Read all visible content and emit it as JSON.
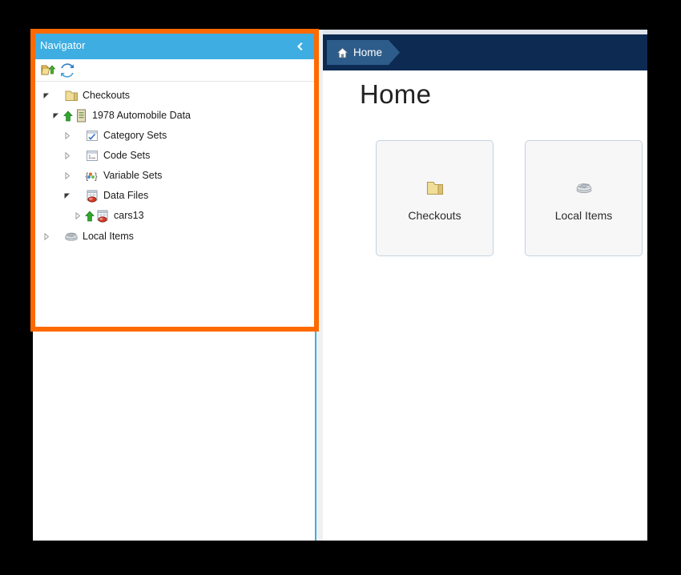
{
  "window": {
    "background_color": "#ffffff",
    "outer_background_color": "#000000"
  },
  "highlight": {
    "color": "#ff6a00",
    "target": "navigator-panel"
  },
  "navigator": {
    "title": "Navigator",
    "header_color": "#3eaee2",
    "collapse_icon": "chevron-left-double-icon",
    "toolbar": [
      {
        "name": "open-folder-up-icon",
        "tooltip": "Open"
      },
      {
        "name": "refresh-icon",
        "tooltip": "Refresh"
      }
    ],
    "tree": [
      {
        "label": "Checkouts",
        "icon": "folder-icon",
        "depth": 0,
        "expanded": true,
        "has_children": true,
        "has_up_arrow": false
      },
      {
        "label": "1978 Automobile Data",
        "icon": "project-document-icon",
        "depth": 1,
        "expanded": true,
        "has_children": true,
        "has_up_arrow": true
      },
      {
        "label": "Category Sets",
        "icon": "category-sets-icon",
        "depth": 2,
        "expanded": false,
        "has_children": true,
        "has_up_arrow": false
      },
      {
        "label": "Code Sets",
        "icon": "code-sets-icon",
        "depth": 2,
        "expanded": false,
        "has_children": true,
        "has_up_arrow": false
      },
      {
        "label": "Variable Sets",
        "icon": "variable-sets-icon",
        "depth": 2,
        "expanded": false,
        "has_children": true,
        "has_up_arrow": false
      },
      {
        "label": "Data Files",
        "icon": "data-files-icon",
        "depth": 2,
        "expanded": true,
        "has_children": true,
        "has_up_arrow": false
      },
      {
        "label": "cars13",
        "icon": "data-file-icon",
        "depth": 3,
        "expanded": false,
        "has_children": true,
        "has_up_arrow": true
      },
      {
        "label": "Local Items",
        "icon": "local-items-icon",
        "depth": 0,
        "expanded": false,
        "has_children": true,
        "has_up_arrow": false
      }
    ]
  },
  "content": {
    "breadcrumb": {
      "bar_color": "#0d2a52",
      "items": [
        {
          "label": "Home",
          "icon": "home-icon",
          "active": true
        }
      ]
    },
    "heading": "Home",
    "cards": [
      {
        "label": "Checkouts",
        "icon": "folder-icon"
      },
      {
        "label": "Local Items",
        "icon": "local-items-icon"
      }
    ]
  }
}
